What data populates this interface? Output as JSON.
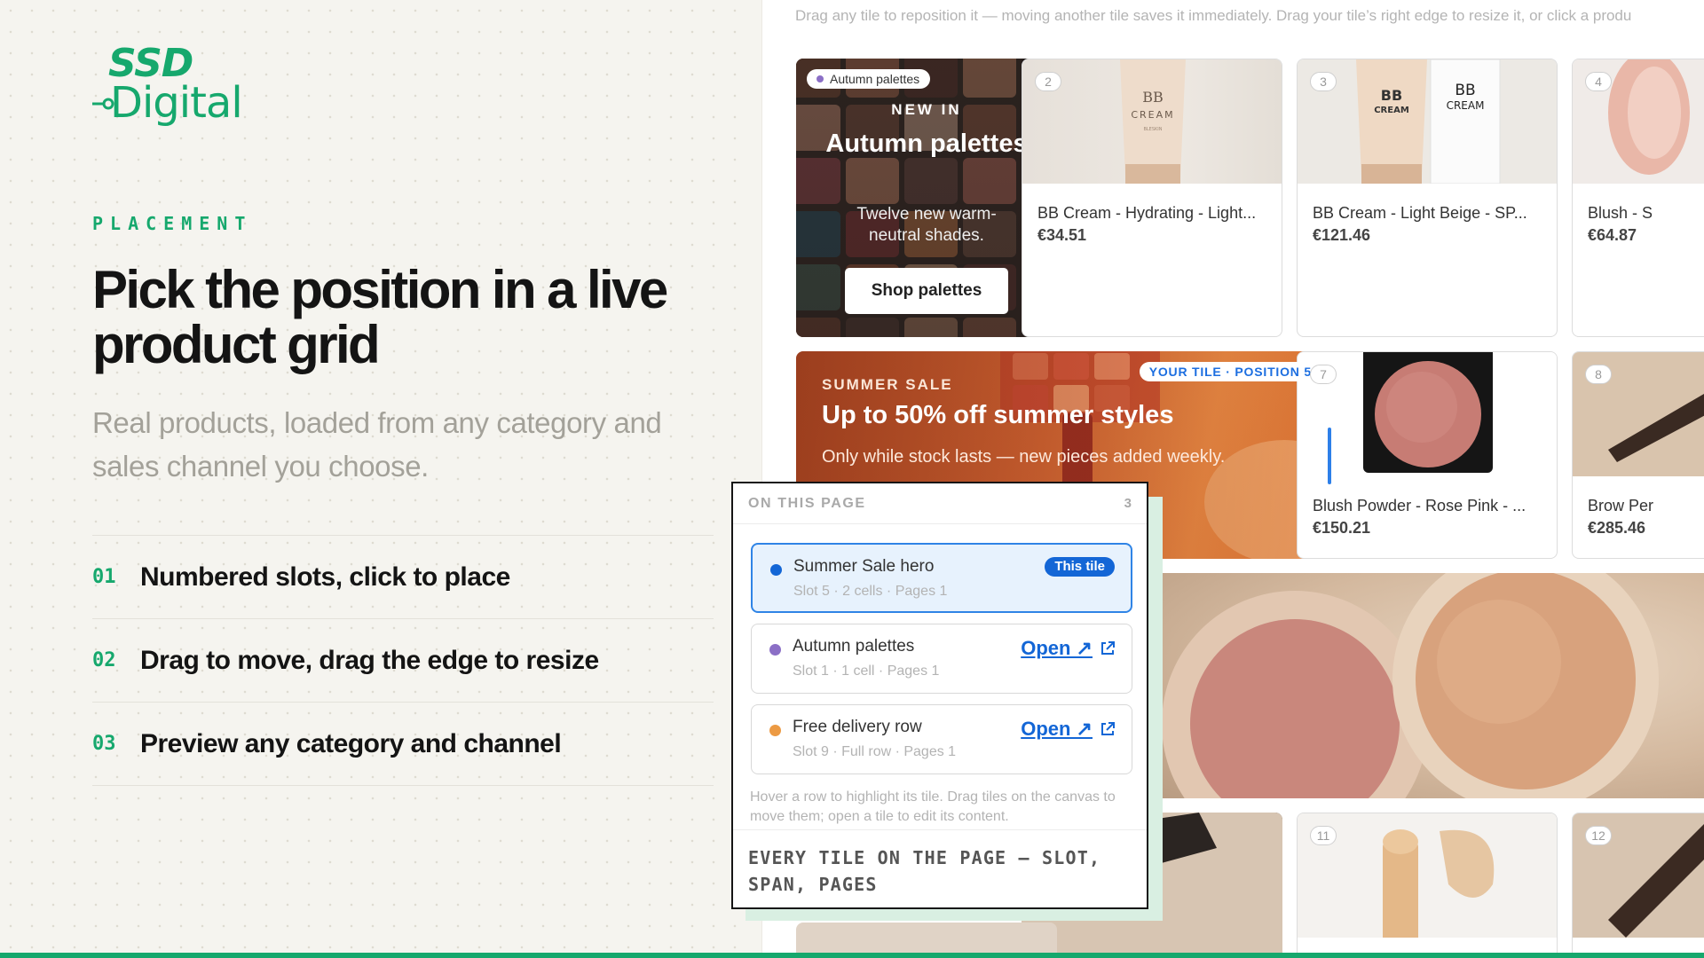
{
  "brand": {
    "logo_top": "SSD",
    "logo_bottom": "Digital",
    "accent": "#16a86d"
  },
  "intro": {
    "eyebrow": "PLACEMENT",
    "headline": "Pick the position in a live product grid",
    "subhead": "Real products, loaded from any category and sales channel you choose."
  },
  "features": [
    {
      "num": "01",
      "text": "Numbered slots, click to place"
    },
    {
      "num": "02",
      "text": "Drag to move, drag the edge to resize"
    },
    {
      "num": "03",
      "text": "Preview any category and channel"
    }
  ],
  "canvas": {
    "hint": "Drag any tile to reposition it — moving another tile saves it immediately. Drag your tile’s right edge to resize it, or click a produ",
    "autumn_tile": {
      "badge": "Autumn palettes",
      "kicker": "NEW IN",
      "title": "Autumn palettes",
      "body": "Twelve new warm-neutral shades.",
      "button": "Shop palettes"
    },
    "summer_tile": {
      "kicker": "SUMMER SALE",
      "title": "Up to 50% off summer styles",
      "body": "Only while stock lasts — new pieces added weekly.",
      "position_badge": "YOUR TILE · POSITION 5"
    },
    "products": [
      {
        "slot": "2",
        "name": "BB Cream - Hydrating - Light...",
        "price": "€34.51"
      },
      {
        "slot": "3",
        "name": "BB Cream - Light Beige - SP...",
        "price": "€121.46"
      },
      {
        "slot": "4",
        "name": "Blush - S",
        "price": "€64.87"
      },
      {
        "slot": "7",
        "name": "Blush Powder - Rose Pink - ...",
        "price": "€150.21"
      },
      {
        "slot": "8",
        "name": "Brow Per",
        "price": "€285.46"
      },
      {
        "slot": "11"
      },
      {
        "slot": "12"
      }
    ],
    "tube_labels": {
      "bb": "BB",
      "cream": "CREAM",
      "tiny": "BLESKIN"
    }
  },
  "panel": {
    "title": "ON THIS PAGE",
    "count": "3",
    "rows": [
      {
        "name": "Summer Sale hero",
        "meta": "Slot 5 · 2 cells · Pages 1",
        "badge": "This tile",
        "dot": "#1366d6"
      },
      {
        "name": "Autumn palettes",
        "meta": "Slot 1 · 1 cell · Pages 1",
        "action": "Open ↗",
        "dot": "#8b6fc6"
      },
      {
        "name": "Free delivery row",
        "meta": "Slot 9 · Full row · Pages 1",
        "action": "Open ↗",
        "dot": "#ec9a43"
      }
    ],
    "footer": "Hover a row to highlight its tile. Drag tiles on the canvas to move them; open a tile to edit its content.",
    "caption": "EVERY TILE ON THE PAGE — SLOT, SPAN, PAGES"
  }
}
